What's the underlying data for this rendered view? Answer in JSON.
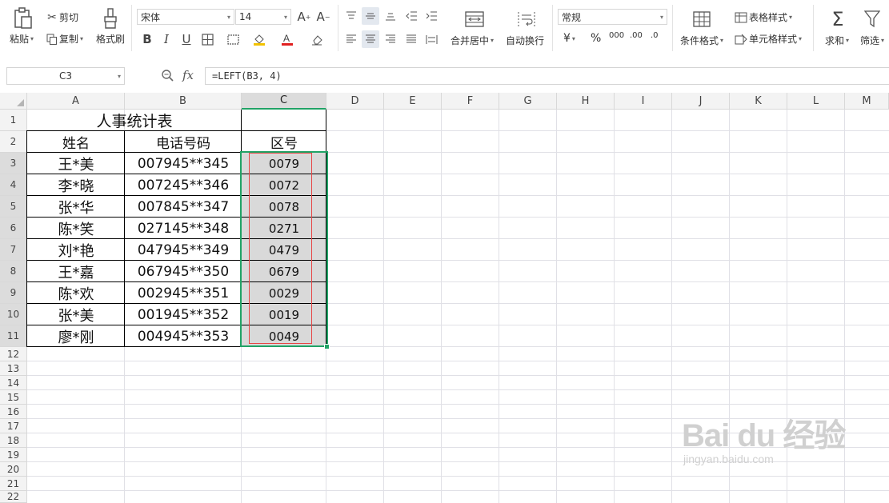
{
  "ribbon": {
    "paste": "粘贴",
    "cut": "剪切",
    "copy": "复制",
    "format_painter": "格式刷",
    "font_name": "宋体",
    "font_size": "14",
    "bold": "B",
    "italic": "I",
    "underline": "U",
    "merge_center": "合并居中",
    "wrap_text": "自动换行",
    "number_format": "常规",
    "currency_symbol": "¥",
    "percent_symbol": "%",
    "thousands_symbol": "000",
    "increase_decimal": ".00",
    "decrease_decimal": ".0",
    "conditional_format": "条件格式",
    "table_style": "表格样式",
    "cell_style": "单元格样式",
    "sum": "求和",
    "filter": "筛选"
  },
  "formula_bar": {
    "name_box": "C3",
    "fx": "fx",
    "formula": "=LEFT(B3, 4)"
  },
  "columns": [
    "A",
    "B",
    "C",
    "D",
    "E",
    "F",
    "G",
    "H",
    "I",
    "J",
    "K",
    "L",
    "M"
  ],
  "rows": [
    "1",
    "2",
    "3",
    "4",
    "5",
    "6",
    "7",
    "8",
    "9",
    "10",
    "11",
    "12",
    "13",
    "14",
    "15",
    "16",
    "17",
    "18",
    "19",
    "20",
    "21",
    "22"
  ],
  "sheet": {
    "title": "人事统计表",
    "headers": [
      "姓名",
      "电话号码",
      "区号"
    ],
    "data": [
      [
        "王*美",
        "007945**345",
        "0079"
      ],
      [
        "李*晓",
        "007245**346",
        "0072"
      ],
      [
        "张*华",
        "007845**347",
        "0078"
      ],
      [
        "陈*笑",
        "027145**348",
        "0271"
      ],
      [
        "刘*艳",
        "047945**349",
        "0479"
      ],
      [
        "王*嘉",
        "067945**350",
        "0679"
      ],
      [
        "陈*欢",
        "002945**351",
        "0029"
      ],
      [
        "张*美",
        "001945**352",
        "0019"
      ],
      [
        "廖*刚",
        "004945**353",
        "0049"
      ]
    ]
  },
  "selection": {
    "active_cell": "C3",
    "range": "C3:C11"
  },
  "watermark": {
    "brand": "Bai du 经验",
    "url": "jingyan.baidu.com"
  },
  "colors": {
    "accent": "#21a366",
    "highlight": "#e64545",
    "selection_fill": "#d9d9d9"
  }
}
